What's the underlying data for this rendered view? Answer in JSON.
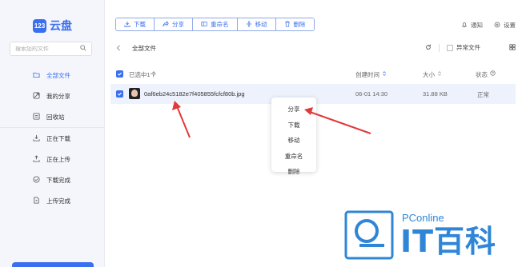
{
  "app": {
    "logo_mark": "123",
    "logo_text": "云盘"
  },
  "search": {
    "placeholder": "搜索您的文件"
  },
  "sidebar": {
    "items": [
      {
        "label": "全部文件",
        "icon": "folder-icon",
        "active": true
      },
      {
        "label": "我的分享",
        "icon": "share-icon"
      },
      {
        "label": "回收站",
        "icon": "trash-icon"
      },
      {
        "label": "正在下载",
        "icon": "download-icon"
      },
      {
        "label": "正在上传",
        "icon": "upload-icon"
      },
      {
        "label": "下载完成",
        "icon": "check-circle-icon"
      },
      {
        "label": "上传完成",
        "icon": "file-icon"
      }
    ]
  },
  "toolbar": {
    "download": "下载",
    "share": "分享",
    "rename": "重命名",
    "move": "移动",
    "delete": "删除"
  },
  "header_right": {
    "notify": "通知",
    "settings": "设置"
  },
  "breadcrumb": {
    "current": "全部文件"
  },
  "filters": {
    "abnormal_files": "异常文件"
  },
  "table": {
    "selected_label": "已选中1个",
    "columns": {
      "created": "创建时间",
      "size": "大小",
      "status": "状态"
    },
    "rows": [
      {
        "name": "0af6eb24c5182e7f405855fcfcf80b.jpg",
        "created": "06-01 14:30",
        "size": "31.88 KB",
        "status": "正常"
      }
    ]
  },
  "context_menu": {
    "items": [
      "分享",
      "下载",
      "移动",
      "重命名",
      "删除"
    ]
  },
  "watermark": {
    "pc": "PConline",
    "it": "IT百科"
  },
  "colors": {
    "accent": "#3a6ff0",
    "arrow": "#e03a3a",
    "watermark": "#2f86d6"
  }
}
